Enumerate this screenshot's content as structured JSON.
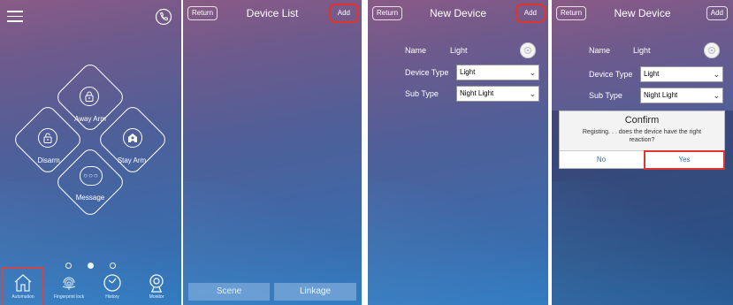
{
  "screen1": {
    "menu_icon": "hamburger-menu-icon",
    "phone_icon": "phone-icon",
    "items": [
      {
        "label": "Away Arm",
        "icon": "lock-closed-icon"
      },
      {
        "label": "Disarm",
        "icon": "lock-open-icon"
      },
      {
        "label": "Stay Arm",
        "icon": "home-person-icon"
      },
      {
        "label": "Message",
        "icon": "message-bubble-icon"
      }
    ],
    "page_dots": 3,
    "active_dot": 1,
    "tabs": [
      {
        "label": "Automation",
        "icon": "house-icon"
      },
      {
        "label": "Fingerprint lock",
        "icon": "fingerprint-icon"
      },
      {
        "label": "History",
        "icon": "clock-icon"
      },
      {
        "label": "Monitor",
        "icon": "camera-icon"
      }
    ]
  },
  "screen2": {
    "return_label": "Return",
    "title": "Device  List",
    "add_label": "Add",
    "scene_label": "Scene",
    "linkage_label": "Linkage"
  },
  "screen3": {
    "return_label": "Return",
    "title": "New  Device",
    "add_label": "Add",
    "name_label": "Name",
    "name_value": "Light",
    "device_type_label": "Device Type",
    "device_type_value": "Light",
    "sub_type_label": "Sub Type",
    "sub_type_value": "Night Light"
  },
  "screen4": {
    "return_label": "Return",
    "title": "New  Device",
    "add_label": "Add",
    "name_label": "Name",
    "name_value": "Light",
    "device_type_label": "Device Type",
    "device_type_value": "Light",
    "sub_type_label": "Sub Type",
    "sub_type_value": "Night Light",
    "dialog": {
      "title": "Confirm",
      "message": "Registing. . . does the device have the right reaction?",
      "no_label": "No",
      "yes_label": "Yes"
    }
  },
  "colors": {
    "highlight": "#e0342e",
    "dialog_button_text": "#1e70c8"
  }
}
